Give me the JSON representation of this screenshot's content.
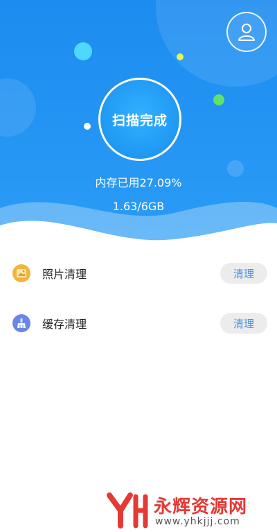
{
  "header": {
    "scan_status": "扫描完成",
    "memory_used_text": "内存已用27.09%",
    "memory_total_text": "1.63/6GB",
    "memory_used_percent": 27.09
  },
  "actions": [
    {
      "label": "照片清理",
      "button": "清理",
      "icon": "photo-icon",
      "icon_color": "#f2b43c"
    },
    {
      "label": "缓存清理",
      "button": "清理",
      "icon": "broom-icon",
      "icon_color": "#6a86e8"
    }
  ],
  "watermark": {
    "brand": "永辉资源网",
    "url": "www.yhkjjj.com"
  },
  "colors": {
    "header_blue": "#1e90f0",
    "button_text": "#4a8fe0",
    "button_bg": "#ececec"
  }
}
